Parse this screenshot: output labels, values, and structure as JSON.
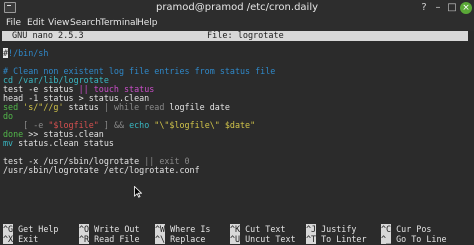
{
  "window": {
    "title": "pramod@pramod /etc/cron.daily",
    "controls": [
      "?",
      "–",
      "□",
      "×"
    ]
  },
  "menu": [
    "File",
    "Edit",
    "View",
    "Search",
    "Terminal",
    "Help"
  ],
  "nano": {
    "app": "GNU nano 2.5.3",
    "file": "File: logrotate"
  },
  "lines": {
    "shebang_rest": "!/bin/sh",
    "comment": "# Clean non existent log file entries from status file",
    "cd": "cd /var/lib/logrotate",
    "test_a": "test -e status ",
    "test_b": "|| touch status",
    "head": "head -1 status > status.clean",
    "sed_a": "sed ",
    "sed_b": "'s/\"//g'",
    "sed_c": " status ",
    "sed_d": "| while read ",
    "sed_e": "logfile date",
    "do": "do",
    "if_a": "    [ -e ",
    "if_b": "\"$logfile\"",
    "if_c": " ] && ",
    "if_d": "echo ",
    "if_e": "\"\\\"$logfile\\\" $date\"",
    "done_a": "done",
    "done_b": " >> status.clean",
    "mv_a": "mv",
    "mv_b": " status.clean status",
    "test2_a": "test -x /usr/sbin/logrotate ",
    "test2_b": "|| exit 0",
    "run": "/usr/sbin/logrotate /etc/logrotate.conf"
  },
  "help_row1": [
    {
      "key": "^G",
      "label": "Get Help"
    },
    {
      "key": "^O",
      "label": "Write Out"
    },
    {
      "key": "^W",
      "label": "Where Is"
    },
    {
      "key": "^K",
      "label": "Cut Text"
    },
    {
      "key": "^J",
      "label": "Justify"
    },
    {
      "key": "^C",
      "label": "Cur Pos"
    }
  ],
  "help_row2": [
    {
      "key": "^X",
      "label": "Exit"
    },
    {
      "key": "^R",
      "label": "Read File"
    },
    {
      "key": "^\\",
      "label": "Replace"
    },
    {
      "key": "^U",
      "label": "Uncut Text"
    },
    {
      "key": "^T",
      "label": "To Linter"
    },
    {
      "key": "^_",
      "label": "Go To Line"
    }
  ]
}
